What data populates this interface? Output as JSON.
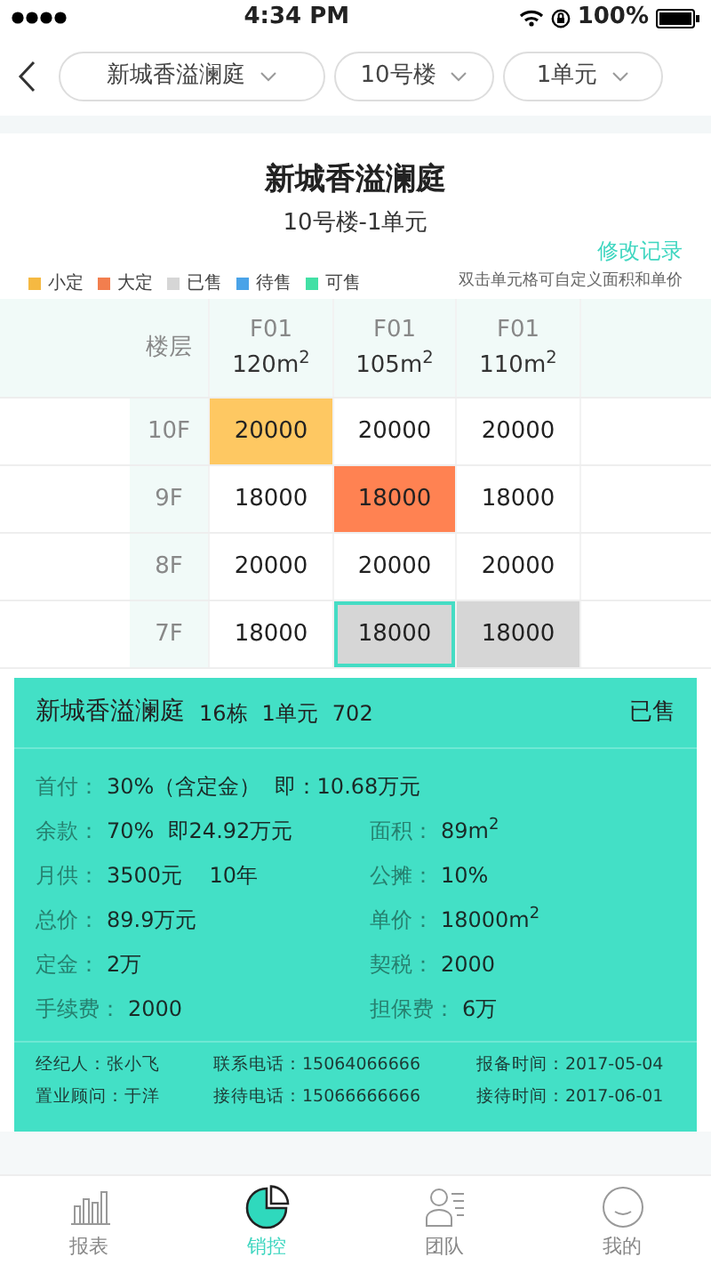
{
  "status_bar": {
    "time": "4:34 PM",
    "battery": "100%"
  },
  "filters": [
    {
      "label": "新城香溢澜庭"
    },
    {
      "label": "10号楼"
    },
    {
      "label": "1单元"
    }
  ],
  "title": "新城香溢澜庭",
  "subtitle": "10号楼-1单元",
  "edit_link": "修改记录",
  "legend": [
    {
      "label": "小定",
      "color": "#f5b942"
    },
    {
      "label": "大定",
      "color": "#f27e4e"
    },
    {
      "label": "已售",
      "color": "#d6d6d6"
    },
    {
      "label": "待售",
      "color": "#4aa3e8"
    },
    {
      "label": "可售",
      "color": "#42e0a5"
    }
  ],
  "hint": "双击单元格可自定义面积和单价",
  "table": {
    "floor_header": "楼层",
    "columns": [
      {
        "unit": "F01",
        "area": "120m$^{2}$"
      },
      {
        "unit": "F01",
        "area": "105m$^{2}$"
      },
      {
        "unit": "F01",
        "area": "110m$^{2}$"
      }
    ],
    "rows": [
      {
        "floor": "10F",
        "cells": [
          {
            "price": "20000",
            "color": "#fec862",
            "selected": false
          },
          {
            "price": "20000",
            "selected": false
          },
          {
            "price": "20000",
            "selected": false
          }
        ]
      },
      {
        "floor": "9F",
        "cells": [
          {
            "price": "18000",
            "selected": false
          },
          {
            "price": "18000",
            "color": "#ff8252",
            "selected": false
          },
          {
            "price": "18000",
            "selected": false
          }
        ]
      },
      {
        "floor": "8F",
        "cells": [
          {
            "price": "20000",
            "selected": false
          },
          {
            "price": "20000",
            "selected": false
          },
          {
            "price": "20000",
            "selected": false
          }
        ]
      },
      {
        "floor": "7F",
        "cells": [
          {
            "price": "18000",
            "selected": false
          },
          {
            "price": "18000",
            "color": "#d6d6d6",
            "selected": true
          },
          {
            "price": "18000",
            "color": "#d6d6d6",
            "selected": false
          }
        ]
      }
    ]
  },
  "popup": {
    "name": "新城香溢澜庭",
    "building": "16栋",
    "unit": "1单元",
    "room": "702",
    "status": "已售",
    "details": [
      [
        {
          "label": "首付：",
          "value": "30%（含定金）  即：10.68万元"
        }
      ],
      [
        {
          "label": "余款：",
          "value": "70%  即24.92万元"
        },
        {
          "label": "面积：",
          "value": "89m$^{2}$"
        }
      ],
      [
        {
          "label": "月供：",
          "value": "3500元    10年"
        },
        {
          "label": "公摊：",
          "value": "10%"
        }
      ],
      [
        {
          "label": "总价：",
          "value": "89.9万元"
        },
        {
          "label": "单价：",
          "value": "18000m$^{2}$"
        }
      ],
      [
        {
          "label": "定金：",
          "value": "2万"
        },
        {
          "label": "契税：",
          "value": "2000"
        }
      ],
      [
        {
          "label": "手续费：",
          "value": "2000"
        },
        {
          "label": "担保费：",
          "value": "6万"
        }
      ]
    ],
    "contacts": [
      [
        "经纪人：张小飞",
        "联系电话：15064066666",
        "报备时间：2017-05-04"
      ],
      [
        "置业顾问：于洋",
        "接待电话：15066666666",
        "接待时间：2017-06-01"
      ]
    ]
  },
  "tabs": [
    {
      "label": "报表",
      "selected": false
    },
    {
      "label": "销控",
      "selected": true
    },
    {
      "label": "团队",
      "selected": false
    },
    {
      "label": "我的",
      "selected": false
    }
  ]
}
